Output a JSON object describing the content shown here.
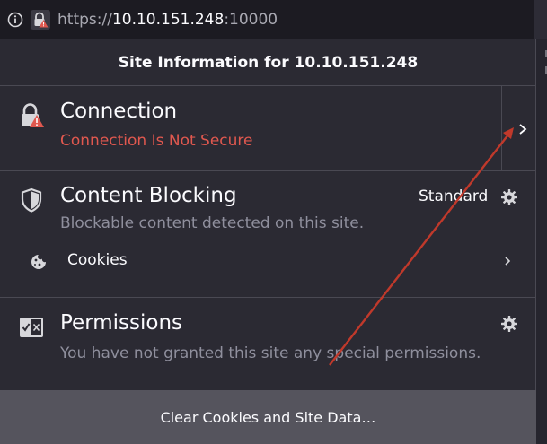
{
  "urlbar": {
    "scheme": "https://",
    "host": "10.10.151.248",
    "port": ":10000"
  },
  "panel": {
    "title": "Site Information for 10.10.151.248",
    "connection": {
      "title": "Connection",
      "status": "Connection Is Not Secure",
      "icon": "insecure-lock-icon"
    },
    "content_blocking": {
      "title": "Content Blocking",
      "level": "Standard",
      "description": "Blockable content detected on this site.",
      "icon": "shield-icon",
      "cookies_label": "Cookies"
    },
    "permissions": {
      "title": "Permissions",
      "description": "You have not granted this site any special permissions.",
      "icon": "permissions-icon"
    },
    "footer_button": "Clear Cookies and Site Data…"
  },
  "colors": {
    "background": "#2b2a33",
    "urlbar": "#1c1b22",
    "insecure": "#e0584f",
    "annotation_arrow": "#c0392b",
    "footer": "#55545d"
  }
}
